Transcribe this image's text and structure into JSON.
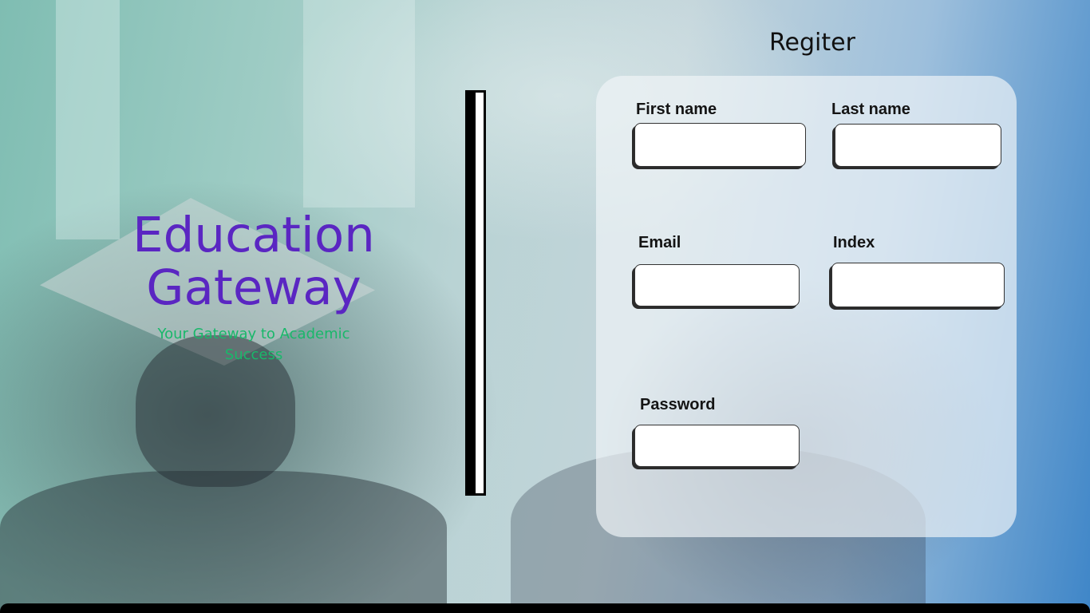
{
  "brand": {
    "title_line1": "Education",
    "title_line2": "Gateway",
    "tagline": "Your Gateway to Academic Success",
    "title_color": "#5a26c2",
    "tagline_color": "#19b86a"
  },
  "register": {
    "title": "Regiter"
  },
  "form": {
    "first_name": {
      "label": "First name",
      "value": ""
    },
    "last_name": {
      "label": "Last name",
      "value": ""
    },
    "email": {
      "label": "Email",
      "value": ""
    },
    "index": {
      "label": "Index",
      "value": ""
    },
    "password": {
      "label": "Password",
      "value": ""
    }
  }
}
